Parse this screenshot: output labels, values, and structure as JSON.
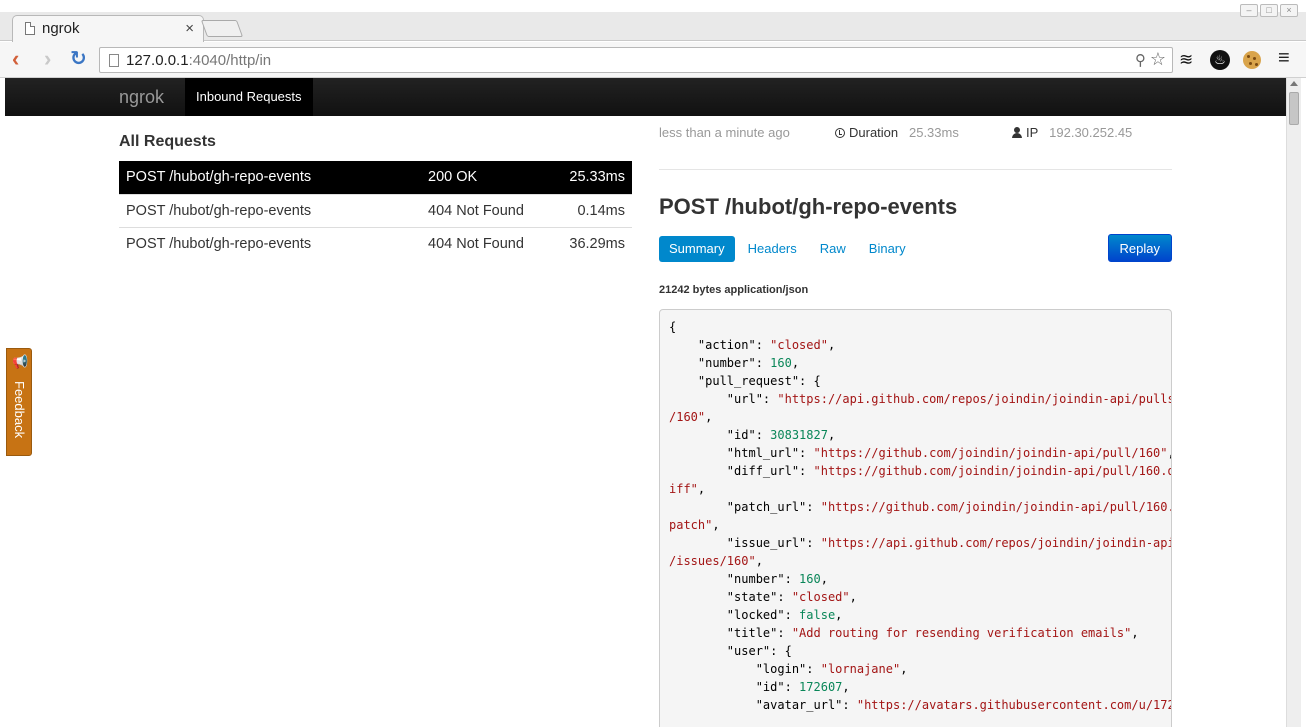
{
  "browser": {
    "tab_title": "ngrok",
    "tab_close": "×",
    "url_host": "127.0.0.1",
    "url_rest": ":4040/http/in"
  },
  "navbar": {
    "brand": "ngrok",
    "active_item": "Inbound Requests"
  },
  "requests": {
    "title": "All Requests",
    "rows": [
      {
        "request": "POST /hubot/gh-repo-events",
        "status": "200 OK",
        "duration": "25.33ms",
        "selected": true
      },
      {
        "request": "POST /hubot/gh-repo-events",
        "status": "404 Not Found",
        "duration": "0.14ms",
        "selected": false
      },
      {
        "request": "POST /hubot/gh-repo-events",
        "status": "404 Not Found",
        "duration": "36.29ms",
        "selected": false
      }
    ]
  },
  "detail": {
    "when": "less than a minute ago",
    "duration_label": "Duration",
    "duration_value": "25.33ms",
    "ip_label": "IP",
    "ip_value": "192.30.252.45",
    "heading": "POST /hubot/gh-repo-events",
    "tabs": [
      "Summary",
      "Headers",
      "Raw",
      "Binary"
    ],
    "active_tab": "Summary",
    "replay_label": "Replay",
    "bytes_info": "21242 bytes application/json",
    "json_lines": [
      [
        {
          "t": "p",
          "v": "{"
        }
      ],
      [
        {
          "t": "p",
          "v": "    \"action\": "
        },
        {
          "t": "s",
          "v": "\"closed\""
        },
        {
          "t": "p",
          "v": ","
        }
      ],
      [
        {
          "t": "p",
          "v": "    \"number\": "
        },
        {
          "t": "n",
          "v": "160"
        },
        {
          "t": "p",
          "v": ","
        }
      ],
      [
        {
          "t": "p",
          "v": "    \"pull_request\": {"
        }
      ],
      [
        {
          "t": "p",
          "v": "        \"url\": "
        },
        {
          "t": "s",
          "v": "\"https://api.github.com/repos/joindin/joindin-api/pulls"
        }
      ],
      [
        {
          "t": "s",
          "v": "/160\""
        },
        {
          "t": "p",
          "v": ","
        }
      ],
      [
        {
          "t": "p",
          "v": "        \"id\": "
        },
        {
          "t": "n",
          "v": "30831827"
        },
        {
          "t": "p",
          "v": ","
        }
      ],
      [
        {
          "t": "p",
          "v": "        \"html_url\": "
        },
        {
          "t": "s",
          "v": "\"https://github.com/joindin/joindin-api/pull/160\""
        },
        {
          "t": "p",
          "v": ","
        }
      ],
      [
        {
          "t": "p",
          "v": "        \"diff_url\": "
        },
        {
          "t": "s",
          "v": "\"https://github.com/joindin/joindin-api/pull/160.d"
        }
      ],
      [
        {
          "t": "s",
          "v": "iff\""
        },
        {
          "t": "p",
          "v": ","
        }
      ],
      [
        {
          "t": "p",
          "v": "        \"patch_url\": "
        },
        {
          "t": "s",
          "v": "\"https://github.com/joindin/joindin-api/pull/160."
        }
      ],
      [
        {
          "t": "s",
          "v": "patch\""
        },
        {
          "t": "p",
          "v": ","
        }
      ],
      [
        {
          "t": "p",
          "v": "        \"issue_url\": "
        },
        {
          "t": "s",
          "v": "\"https://api.github.com/repos/joindin/joindin-api"
        }
      ],
      [
        {
          "t": "s",
          "v": "/issues/160\""
        },
        {
          "t": "p",
          "v": ","
        }
      ],
      [
        {
          "t": "p",
          "v": "        \"number\": "
        },
        {
          "t": "n",
          "v": "160"
        },
        {
          "t": "p",
          "v": ","
        }
      ],
      [
        {
          "t": "p",
          "v": "        \"state\": "
        },
        {
          "t": "s",
          "v": "\"closed\""
        },
        {
          "t": "p",
          "v": ","
        }
      ],
      [
        {
          "t": "p",
          "v": "        \"locked\": "
        },
        {
          "t": "b",
          "v": "false"
        },
        {
          "t": "p",
          "v": ","
        }
      ],
      [
        {
          "t": "p",
          "v": "        \"title\": "
        },
        {
          "t": "s",
          "v": "\"Add routing for resending verification emails\""
        },
        {
          "t": "p",
          "v": ","
        }
      ],
      [
        {
          "t": "p",
          "v": "        \"user\": {"
        }
      ],
      [
        {
          "t": "p",
          "v": "            \"login\": "
        },
        {
          "t": "s",
          "v": "\"lornajane\""
        },
        {
          "t": "p",
          "v": ","
        }
      ],
      [
        {
          "t": "p",
          "v": "            \"id\": "
        },
        {
          "t": "n",
          "v": "172607"
        },
        {
          "t": "p",
          "v": ","
        }
      ],
      [
        {
          "t": "p",
          "v": "            \"avatar_url\": "
        },
        {
          "t": "s",
          "v": "\"https://avatars.githubusercontent.com/u/172"
        }
      ]
    ]
  },
  "feedback": {
    "label": "Feedback",
    "icon": "megaphone-icon",
    "color": "#c77314"
  }
}
